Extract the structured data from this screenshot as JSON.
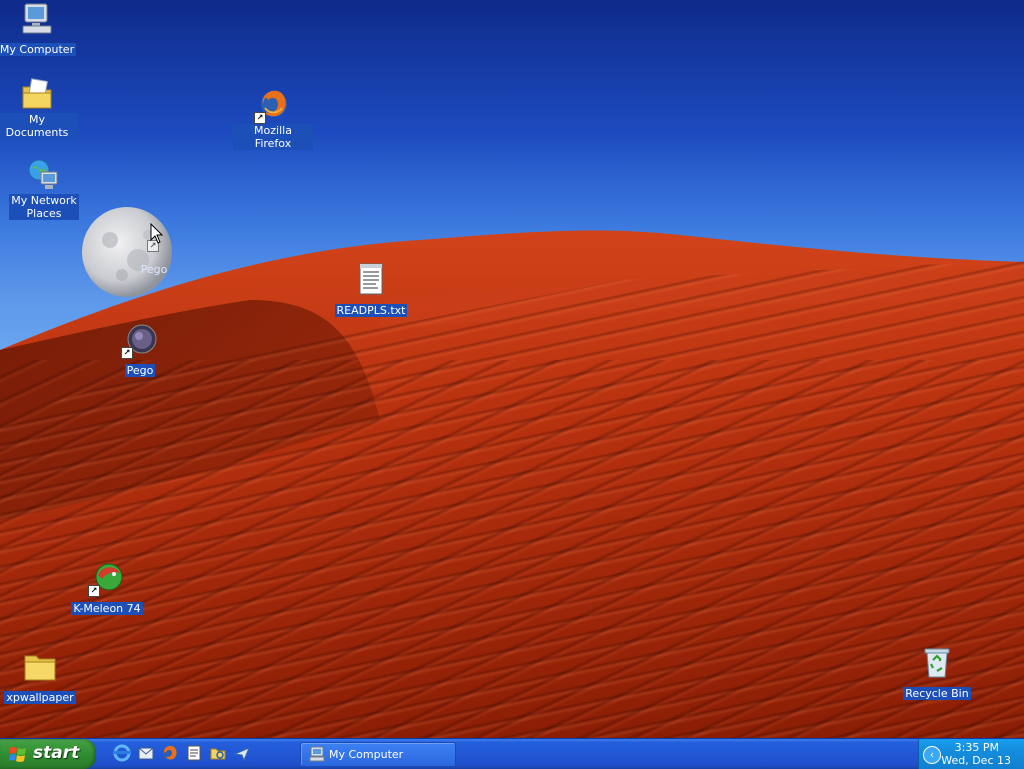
{
  "desktop": {
    "icons": [
      {
        "label": "My Computer",
        "icon": "my-computer-icon"
      },
      {
        "label": "My Documents",
        "icon": "my-documents-icon"
      },
      {
        "label": "My Network\nPlaces",
        "icon": "network-places-icon"
      },
      {
        "label": "Mozilla Firefox",
        "icon": "firefox-icon"
      },
      {
        "label": "Pego",
        "icon": "moon-icon"
      },
      {
        "label": "READPLS.txt",
        "icon": "text-file-icon"
      },
      {
        "label": "Pego",
        "icon": "pego-icon"
      },
      {
        "label": "K-Meleon 74",
        "icon": "kmeleon-icon"
      },
      {
        "label": "xpwallpaper",
        "icon": "folder-icon"
      },
      {
        "label": "Recycle Bin",
        "icon": "recycle-bin-icon"
      }
    ]
  },
  "taskbar": {
    "start_label": "start",
    "quick_launch": [
      "ie-icon",
      "outlook-icon",
      "firefox-icon",
      "notepad-icon",
      "explorer-icon",
      "plane-icon"
    ],
    "tasks": [
      {
        "label": "My Computer",
        "icon": "my-computer-icon"
      }
    ],
    "tray": {
      "time": "3:35 PM",
      "date": "Wed, Dec 13",
      "expand_icon": "chevron-left-icon"
    }
  },
  "colors": {
    "taskbar_blue": "#245edb",
    "start_green": "#3c9a3c",
    "tray_blue": "#158fe0",
    "label_highlight": "#1c4fb8"
  }
}
